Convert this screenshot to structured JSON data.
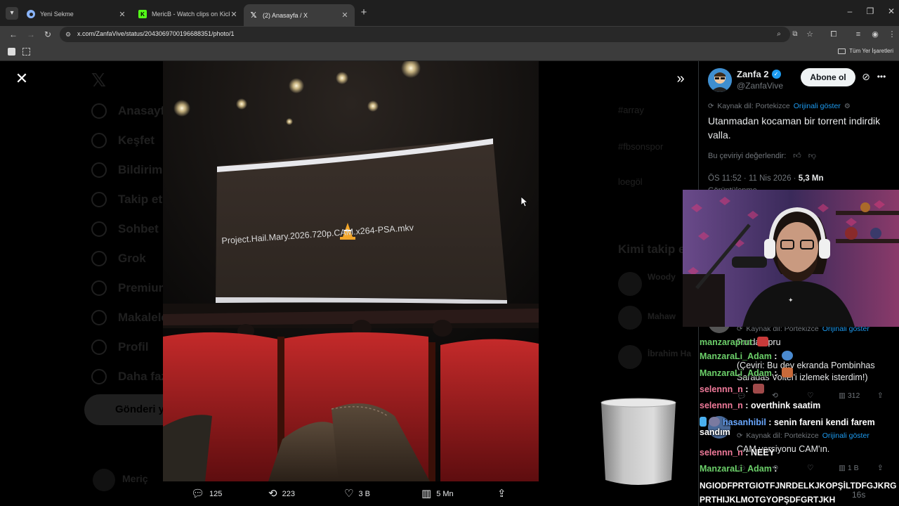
{
  "browser": {
    "tabs": [
      {
        "title": "Yeni Sekme",
        "favicon": "chrome-icon",
        "active": false
      },
      {
        "title": "MericB - Watch clips on Kick",
        "favicon": "kick-icon",
        "active": false
      },
      {
        "title": "(2) Anasayfa / X",
        "favicon": "x-icon",
        "active": true
      }
    ],
    "url": "x.com/ZanfaVive/status/2043069700196688351/photo/1",
    "bookmarks_all": "Tüm Yer İşaretleri"
  },
  "sidebar": {
    "items": [
      "Anasayfa",
      "Keşfet",
      "Bildirimler",
      "Takip et",
      "Sohbet",
      "Grok",
      "Premium",
      "Makaleler",
      "Profil",
      "Daha fazla"
    ],
    "post_button": "Gönderi yayınla",
    "user_short": "Meriç"
  },
  "bg_trends": {
    "items": [
      "#array",
      "#fbsonspor",
      "loegöl"
    ],
    "who_to_follow": "Kimi takip et",
    "people": [
      "Woody",
      "Mahaw",
      "İbrahim Ha"
    ]
  },
  "photo": {
    "screen_text": "Project.Hail.Mary.2026.720p.CAM.x264-PSA.mkv"
  },
  "photo_actions": {
    "replies": "125",
    "reposts": "223",
    "likes": "3 B",
    "views": "5 Mn"
  },
  "tweet": {
    "display_name": "Zanfa 2",
    "handle": "@ZanfaVive",
    "follow_label": "Abone ol",
    "source_lang": "Kaynak dil: Portekizce",
    "show_original": "Orijinali göster",
    "text": "Utanmadan kocaman bir torrent indirdik valla.",
    "rate_translation": "Bu çeviriyi değerlendir:",
    "time_date": "ÖS 11:52 · 11 Nis 2026 · ",
    "views": "5,3 Mn",
    "views_suffix": "Görüntülenme"
  },
  "replies": [
    {
      "source_lang": "Kaynak dil: Portekizce",
      "show_original": "Orijinali göster",
      "text_top": "Prudaurpru",
      "text": "(Çeviri: Bu dev ekranda Pombinhas Saradas Voltei'i izlemek isterdim!)",
      "views": "312"
    },
    {
      "source_lang": "Kaynak dil: Portekizce",
      "show_original": "Orijinali göster",
      "text": "CAM versiyonu CAM'ın.",
      "likes": "1 B",
      "time": "16s"
    }
  ],
  "chat": [
    {
      "user": "manzaraprut",
      "message": "",
      "color": "#6cd06a"
    },
    {
      "user": "ManzaraLi_Adam",
      "message": "",
      "color": "#6cd06a"
    },
    {
      "user": "ManzaraLi_Adam",
      "message": "",
      "color": "#6cd06a"
    },
    {
      "user": "selennn_n",
      "message": "",
      "color": "#f07a9a"
    },
    {
      "user": "selennn_n",
      "message": "overthink saatim",
      "color": "#f07a9a"
    },
    {
      "user": "hasanhibil",
      "message": "senin fareni kendi farem sandım",
      "color": "#6aa8ff"
    },
    {
      "user": "selennn_n",
      "message": "NEEY",
      "color": "#f07a9a"
    },
    {
      "user": "ManzaraLi_Adam",
      "message": "",
      "color": "#6cd06a"
    },
    {
      "user": "",
      "message": "NGIODFPRTGIOTFJNRDELKJKOPŞİLTDFGJKRG PRTHIJKLMOTGYOPŞDFGRTJKH",
      "color": "#ffffff"
    }
  ]
}
